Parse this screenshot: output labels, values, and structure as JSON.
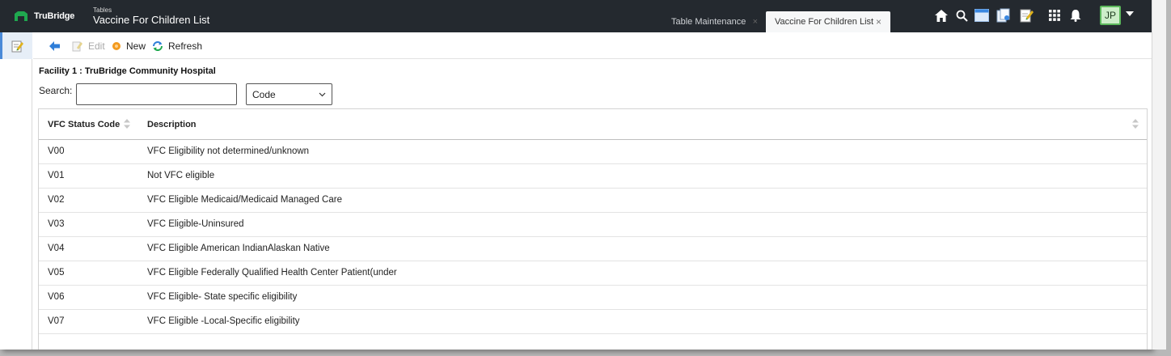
{
  "header": {
    "logo_text": "TruBridge",
    "title_small": "Tables",
    "title_main": "Vaccine For Children List",
    "tabs": [
      {
        "label": "Table Maintenance",
        "close": "×"
      },
      {
        "label": "Vaccine For Children List",
        "close": "×"
      }
    ],
    "icons": [
      "home-icon",
      "search-icon",
      "window-icon",
      "documents-icon",
      "notes-icon",
      "apps-grid-icon",
      "bell-icon"
    ],
    "avatar_initials": "JP"
  },
  "toolbar": {
    "back_icon": "arrow-left-icon",
    "edit_label": "Edit",
    "new_label": "New",
    "refresh_label": "Refresh"
  },
  "content": {
    "facility": "Facility 1 : TruBridge Community Hospital",
    "search_label": "Search:",
    "search_value": "",
    "search_field_option": "Code"
  },
  "table": {
    "columns": [
      "VFC Status Code",
      "Description"
    ],
    "rows": [
      {
        "code": "V00",
        "description": "VFC Eligibility not determined/unknown"
      },
      {
        "code": "V01",
        "description": "Not VFC eligible"
      },
      {
        "code": "V02",
        "description": "VFC Eligible Medicaid/Medicaid Managed Care"
      },
      {
        "code": "V03",
        "description": "VFC Eligible-Uninsured"
      },
      {
        "code": "V04",
        "description": "VFC Eligible American IndianAlaskan Native"
      },
      {
        "code": "V05",
        "description": "VFC Eligible Federally Qualified Health Center Patient(under"
      },
      {
        "code": "V06",
        "description": "VFC Eligible- State specific eligibility"
      },
      {
        "code": "V07",
        "description": "VFC Eligible -Local-Specific eligibility"
      }
    ]
  },
  "colors": {
    "header_bg": "#24292f",
    "brand_green": "#1fa84f",
    "accent_blue": "#4a8ad8",
    "new_orange": "#f39a1e"
  }
}
